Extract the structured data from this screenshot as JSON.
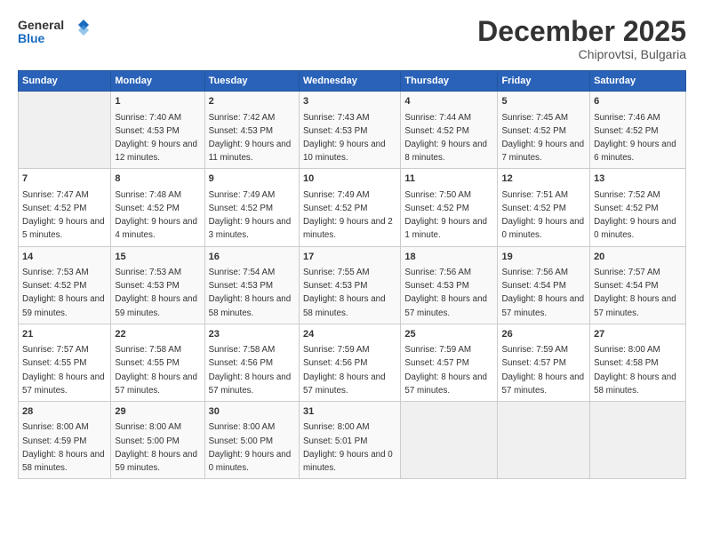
{
  "header": {
    "logo_line1": "General",
    "logo_line2": "Blue",
    "title": "December 2025",
    "subtitle": "Chiprovtsi, Bulgaria"
  },
  "columns": [
    "Sunday",
    "Monday",
    "Tuesday",
    "Wednesday",
    "Thursday",
    "Friday",
    "Saturday"
  ],
  "weeks": [
    [
      {
        "day": "",
        "empty": true
      },
      {
        "day": "1",
        "rise": "Sunrise: 7:40 AM",
        "set": "Sunset: 4:53 PM",
        "daylight": "Daylight: 9 hours and 12 minutes."
      },
      {
        "day": "2",
        "rise": "Sunrise: 7:42 AM",
        "set": "Sunset: 4:53 PM",
        "daylight": "Daylight: 9 hours and 11 minutes."
      },
      {
        "day": "3",
        "rise": "Sunrise: 7:43 AM",
        "set": "Sunset: 4:53 PM",
        "daylight": "Daylight: 9 hours and 10 minutes."
      },
      {
        "day": "4",
        "rise": "Sunrise: 7:44 AM",
        "set": "Sunset: 4:52 PM",
        "daylight": "Daylight: 9 hours and 8 minutes."
      },
      {
        "day": "5",
        "rise": "Sunrise: 7:45 AM",
        "set": "Sunset: 4:52 PM",
        "daylight": "Daylight: 9 hours and 7 minutes."
      },
      {
        "day": "6",
        "rise": "Sunrise: 7:46 AM",
        "set": "Sunset: 4:52 PM",
        "daylight": "Daylight: 9 hours and 6 minutes."
      }
    ],
    [
      {
        "day": "7",
        "rise": "Sunrise: 7:47 AM",
        "set": "Sunset: 4:52 PM",
        "daylight": "Daylight: 9 hours and 5 minutes."
      },
      {
        "day": "8",
        "rise": "Sunrise: 7:48 AM",
        "set": "Sunset: 4:52 PM",
        "daylight": "Daylight: 9 hours and 4 minutes."
      },
      {
        "day": "9",
        "rise": "Sunrise: 7:49 AM",
        "set": "Sunset: 4:52 PM",
        "daylight": "Daylight: 9 hours and 3 minutes."
      },
      {
        "day": "10",
        "rise": "Sunrise: 7:49 AM",
        "set": "Sunset: 4:52 PM",
        "daylight": "Daylight: 9 hours and 2 minutes."
      },
      {
        "day": "11",
        "rise": "Sunrise: 7:50 AM",
        "set": "Sunset: 4:52 PM",
        "daylight": "Daylight: 9 hours and 1 minute."
      },
      {
        "day": "12",
        "rise": "Sunrise: 7:51 AM",
        "set": "Sunset: 4:52 PM",
        "daylight": "Daylight: 9 hours and 0 minutes."
      },
      {
        "day": "13",
        "rise": "Sunrise: 7:52 AM",
        "set": "Sunset: 4:52 PM",
        "daylight": "Daylight: 9 hours and 0 minutes."
      }
    ],
    [
      {
        "day": "14",
        "rise": "Sunrise: 7:53 AM",
        "set": "Sunset: 4:52 PM",
        "daylight": "Daylight: 8 hours and 59 minutes."
      },
      {
        "day": "15",
        "rise": "Sunrise: 7:53 AM",
        "set": "Sunset: 4:53 PM",
        "daylight": "Daylight: 8 hours and 59 minutes."
      },
      {
        "day": "16",
        "rise": "Sunrise: 7:54 AM",
        "set": "Sunset: 4:53 PM",
        "daylight": "Daylight: 8 hours and 58 minutes."
      },
      {
        "day": "17",
        "rise": "Sunrise: 7:55 AM",
        "set": "Sunset: 4:53 PM",
        "daylight": "Daylight: 8 hours and 58 minutes."
      },
      {
        "day": "18",
        "rise": "Sunrise: 7:56 AM",
        "set": "Sunset: 4:53 PM",
        "daylight": "Daylight: 8 hours and 57 minutes."
      },
      {
        "day": "19",
        "rise": "Sunrise: 7:56 AM",
        "set": "Sunset: 4:54 PM",
        "daylight": "Daylight: 8 hours and 57 minutes."
      },
      {
        "day": "20",
        "rise": "Sunrise: 7:57 AM",
        "set": "Sunset: 4:54 PM",
        "daylight": "Daylight: 8 hours and 57 minutes."
      }
    ],
    [
      {
        "day": "21",
        "rise": "Sunrise: 7:57 AM",
        "set": "Sunset: 4:55 PM",
        "daylight": "Daylight: 8 hours and 57 minutes."
      },
      {
        "day": "22",
        "rise": "Sunrise: 7:58 AM",
        "set": "Sunset: 4:55 PM",
        "daylight": "Daylight: 8 hours and 57 minutes."
      },
      {
        "day": "23",
        "rise": "Sunrise: 7:58 AM",
        "set": "Sunset: 4:56 PM",
        "daylight": "Daylight: 8 hours and 57 minutes."
      },
      {
        "day": "24",
        "rise": "Sunrise: 7:59 AM",
        "set": "Sunset: 4:56 PM",
        "daylight": "Daylight: 8 hours and 57 minutes."
      },
      {
        "day": "25",
        "rise": "Sunrise: 7:59 AM",
        "set": "Sunset: 4:57 PM",
        "daylight": "Daylight: 8 hours and 57 minutes."
      },
      {
        "day": "26",
        "rise": "Sunrise: 7:59 AM",
        "set": "Sunset: 4:57 PM",
        "daylight": "Daylight: 8 hours and 57 minutes."
      },
      {
        "day": "27",
        "rise": "Sunrise: 8:00 AM",
        "set": "Sunset: 4:58 PM",
        "daylight": "Daylight: 8 hours and 58 minutes."
      }
    ],
    [
      {
        "day": "28",
        "rise": "Sunrise: 8:00 AM",
        "set": "Sunset: 4:59 PM",
        "daylight": "Daylight: 8 hours and 58 minutes."
      },
      {
        "day": "29",
        "rise": "Sunrise: 8:00 AM",
        "set": "Sunset: 5:00 PM",
        "daylight": "Daylight: 8 hours and 59 minutes."
      },
      {
        "day": "30",
        "rise": "Sunrise: 8:00 AM",
        "set": "Sunset: 5:00 PM",
        "daylight": "Daylight: 9 hours and 0 minutes."
      },
      {
        "day": "31",
        "rise": "Sunrise: 8:00 AM",
        "set": "Sunset: 5:01 PM",
        "daylight": "Daylight: 9 hours and 0 minutes."
      },
      {
        "day": "",
        "empty": true
      },
      {
        "day": "",
        "empty": true
      },
      {
        "day": "",
        "empty": true
      }
    ]
  ]
}
